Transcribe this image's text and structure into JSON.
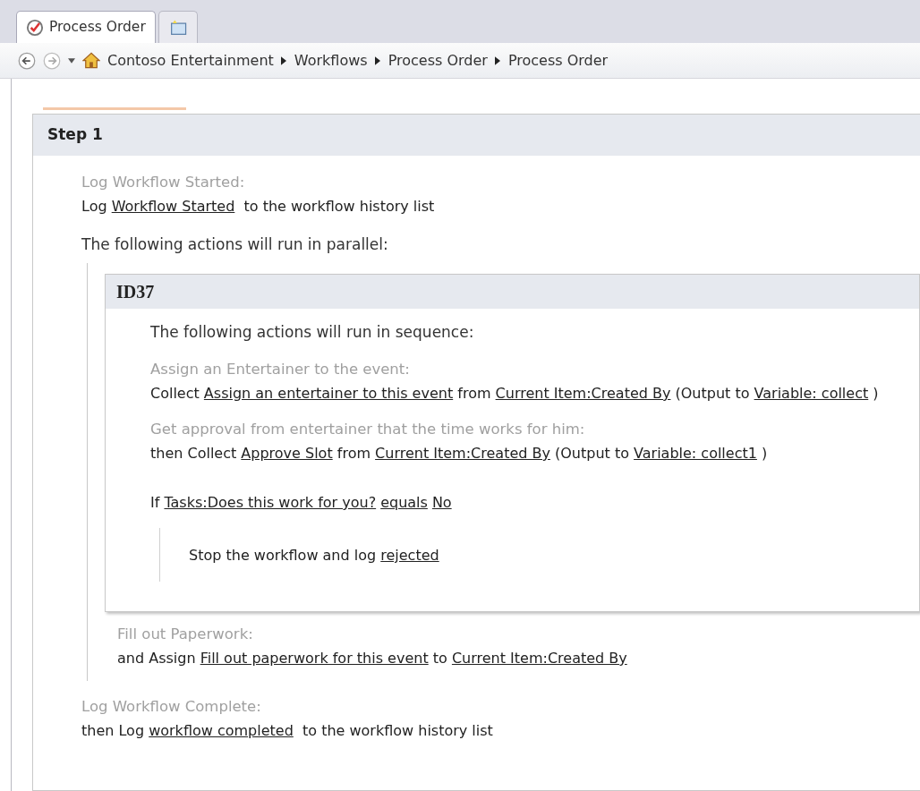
{
  "tabs": [
    {
      "kind": "page",
      "label": "Process Order",
      "selected": true
    },
    {
      "kind": "new",
      "selected": false
    }
  ],
  "breadcrumb": [
    "Contoso Entertainment",
    "Workflows",
    "Process Order",
    "Process Order"
  ],
  "step": {
    "title": "Step 1",
    "items": [
      {
        "kind": "action",
        "caption": "Log Workflow Started:",
        "parts": [
          {
            "text": "Log ",
            "kind": "text"
          },
          {
            "text": "Workflow Started",
            "kind": "link"
          },
          {
            "text": "  to the workflow history list",
            "kind": "text"
          }
        ]
      },
      {
        "kind": "parallel",
        "text": "The following actions will run in parallel:",
        "branches": [
          {
            "kind": "block",
            "title": "ID37",
            "items": [
              {
                "kind": "note",
                "text": "The following actions will run in sequence:"
              },
              {
                "kind": "action",
                "caption": "Assign an Entertainer to the event:",
                "parts": [
                  {
                    "text": "Collect ",
                    "kind": "text"
                  },
                  {
                    "text": "Assign an entertainer to this event",
                    "kind": "link"
                  },
                  {
                    "text": " from ",
                    "kind": "text"
                  },
                  {
                    "text": "Current Item:Created By",
                    "kind": "link"
                  },
                  {
                    "text": " (Output to ",
                    "kind": "text"
                  },
                  {
                    "text": "Variable: collect",
                    "kind": "link"
                  },
                  {
                    "text": " )",
                    "kind": "text"
                  }
                ]
              },
              {
                "kind": "action",
                "caption": "Get approval from entertainer that the time works for him:",
                "parts": [
                  {
                    "text": "then Collect ",
                    "kind": "text"
                  },
                  {
                    "text": "Approve Slot",
                    "kind": "link"
                  },
                  {
                    "text": " from ",
                    "kind": "text"
                  },
                  {
                    "text": "Current Item:Created By",
                    "kind": "link"
                  },
                  {
                    "text": " (Output to ",
                    "kind": "text"
                  },
                  {
                    "text": "Variable: collect1",
                    "kind": "link"
                  },
                  {
                    "text": " )",
                    "kind": "text"
                  }
                ]
              },
              {
                "kind": "condition",
                "parts": [
                  {
                    "text": "If ",
                    "kind": "text"
                  },
                  {
                    "text": "Tasks:Does this work for you?",
                    "kind": "link"
                  },
                  {
                    "text": "equals",
                    "kind": "link"
                  },
                  {
                    "text": "No",
                    "kind": "link"
                  }
                ],
                "children": [
                  {
                    "kind": "action",
                    "parts": [
                      {
                        "text": "Stop the workflow and log ",
                        "kind": "text"
                      },
                      {
                        "text": "rejected",
                        "kind": "link"
                      }
                    ]
                  }
                ]
              }
            ]
          },
          {
            "kind": "action",
            "caption": "Fill out Paperwork:",
            "parts": [
              {
                "text": "and Assign ",
                "kind": "text"
              },
              {
                "text": "Fill out paperwork for this event",
                "kind": "link"
              },
              {
                "text": " to ",
                "kind": "text"
              },
              {
                "text": "Current Item:Created By",
                "kind": "link"
              }
            ]
          }
        ]
      },
      {
        "kind": "action",
        "caption": "Log Workflow Complete:",
        "parts": [
          {
            "text": "then Log ",
            "kind": "text"
          },
          {
            "text": "workflow completed",
            "kind": "link"
          },
          {
            "text": "  to the workflow history list",
            "kind": "text"
          }
        ]
      }
    ]
  }
}
